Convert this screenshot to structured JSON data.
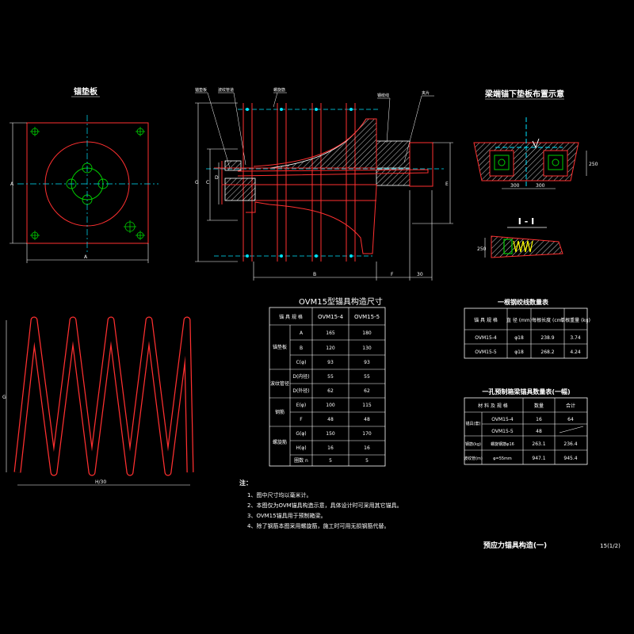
{
  "drawing": {
    "colors": {
      "outline": "#ff3030",
      "center": "#00e5ff",
      "dim": "#ffffff",
      "grid": "#00cc00",
      "hatch": "#ffffff",
      "spring": "#ffff00",
      "background": "#000000"
    },
    "plate_view": {
      "title": "锚垫板",
      "dim_a_v": "A",
      "dim_a_h": "A"
    },
    "section_view": {
      "labels": [
        "锚垫板",
        "波纹管道",
        "螺旋筋",
        "钢绞线",
        "夹片"
      ],
      "dim_g": "G",
      "dim_c": "C",
      "dim_d": "D",
      "dim_e": "E",
      "dim_b": "B",
      "dim_f": "F",
      "dim_30": "30"
    },
    "layout_view": {
      "title": "梁端锚下垫板布置示意",
      "dim_250": "250",
      "dim_300a": "300",
      "dim_300b": "300"
    },
    "section_ii": {
      "title": "I - I",
      "dim_250": "250"
    },
    "spiral_view": {
      "dim_g": "G",
      "dim_h": "H/30"
    },
    "table1": {
      "title": "OVM15型锚具构造尺寸",
      "headers": [
        "锚 具 规 格",
        "",
        "OVM15-4",
        "OVM15-5"
      ],
      "groups": [
        {
          "group": "锚垫板",
          "rows": [
            [
              "A",
              "165",
              "180"
            ],
            [
              "B",
              "120",
              "130"
            ],
            [
              "C(φ)",
              "93",
              "93"
            ]
          ]
        },
        {
          "group": "波纹管径",
          "rows": [
            [
              "D(内径)",
              "55",
              "55"
            ],
            [
              "D(外径)",
              "62",
              "62"
            ]
          ]
        },
        {
          "group": "钢筋",
          "rows": [
            [
              "E(φ)",
              "100",
              "115"
            ],
            [
              "F",
              "48",
              "48"
            ]
          ]
        },
        {
          "group": "螺旋筋",
          "rows": [
            [
              "G(φ)",
              "150",
              "170"
            ],
            [
              "H(φ)",
              "16",
              "16"
            ],
            [
              "圈数 n",
              "5",
              "5"
            ]
          ]
        }
      ]
    },
    "table2": {
      "title": "一根钢绞线数量表",
      "headers": [
        "锚 具 规 格",
        "直 径 (mm)",
        "每根长度 (cm)",
        "单根重量 (kg)"
      ],
      "rows": [
        [
          "OVM15-4",
          "φ18",
          "238.9",
          "3.74"
        ],
        [
          "OVM15-5",
          "φ18",
          "268.2",
          "4.24"
        ]
      ]
    },
    "table3": {
      "title": "一孔预制箱梁锚具数量表(一幅)",
      "headers": [
        "材 料 及 规 格",
        "",
        "数量",
        "合计"
      ],
      "rows": [
        [
          "锚具(套)",
          "OVM15-4",
          "16",
          "64"
        ],
        [
          "",
          "OVM15-5",
          "48",
          ""
        ],
        [
          "钢筋(kg)",
          "螺旋钢筋φ16",
          "263.1",
          "236.4"
        ],
        [
          "波纹管(m)",
          "φ=55mm",
          "947.1",
          "945.4"
        ]
      ]
    },
    "notes": {
      "title": "注：",
      "items": [
        "1、图中尺寸均以毫米计。",
        "2、本图仅为OVM锚具构造示意，具体设计时可采用其它锚具。",
        "3、OVM15锚具用于预制箱梁。",
        "4、除了钢筋本图采用螺旋筋，施工时可用无损钢筋代替。"
      ]
    },
    "footer": {
      "title": "预应力锚具构造(一)",
      "page": "15(1/2)"
    }
  }
}
